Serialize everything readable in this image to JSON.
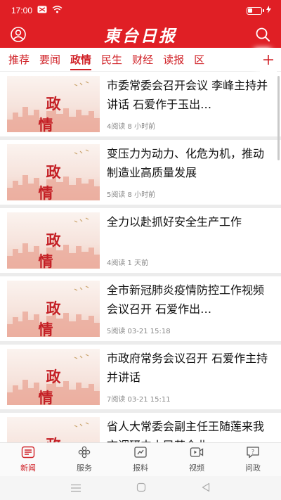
{
  "status_bar": {
    "time": "17:00"
  },
  "header": {
    "logo_text": "東台日报"
  },
  "tabs": [
    {
      "label": "推荐",
      "active": false
    },
    {
      "label": "要闻",
      "active": false
    },
    {
      "label": "政情",
      "active": true
    },
    {
      "label": "民生",
      "active": false
    },
    {
      "label": "财经",
      "active": false
    },
    {
      "label": "读报",
      "active": false
    },
    {
      "label": "区",
      "active": false
    }
  ],
  "thumb_text": "政 情",
  "articles": [
    {
      "title": "市委常委会召开会议 李峰主持并讲话 石爱作于玉出…",
      "meta": "4阅读 8 小时前"
    },
    {
      "title": "变压力为动力、化危为机，推动制造业高质量发展",
      "meta": "5阅读 8 小时前"
    },
    {
      "title": "全力以赴抓好安全生产工作",
      "meta": "4阅读 1 天前"
    },
    {
      "title": "全市新冠肺炎疫情防控工作视频会议召开 石爱作出…",
      "meta": "5阅读 03-21 15:18"
    },
    {
      "title": "市政府常务会议召开 石爱作主持并讲话",
      "meta": "7阅读 03-21 15:11"
    },
    {
      "title": "省人大常委会副主任王随莲来我市调研中小民营企业",
      "meta": ""
    }
  ],
  "bottom_nav": [
    {
      "label": "新闻",
      "icon": "news-icon",
      "active": true
    },
    {
      "label": "服务",
      "icon": "service-icon",
      "active": false
    },
    {
      "label": "报料",
      "icon": "report-icon",
      "active": false
    },
    {
      "label": "视频",
      "icon": "video-icon",
      "active": false
    },
    {
      "label": "问政",
      "icon": "inquiry-icon",
      "active": false
    }
  ],
  "colors": {
    "brand": "#e01f25",
    "tab_text": "#d02026"
  }
}
